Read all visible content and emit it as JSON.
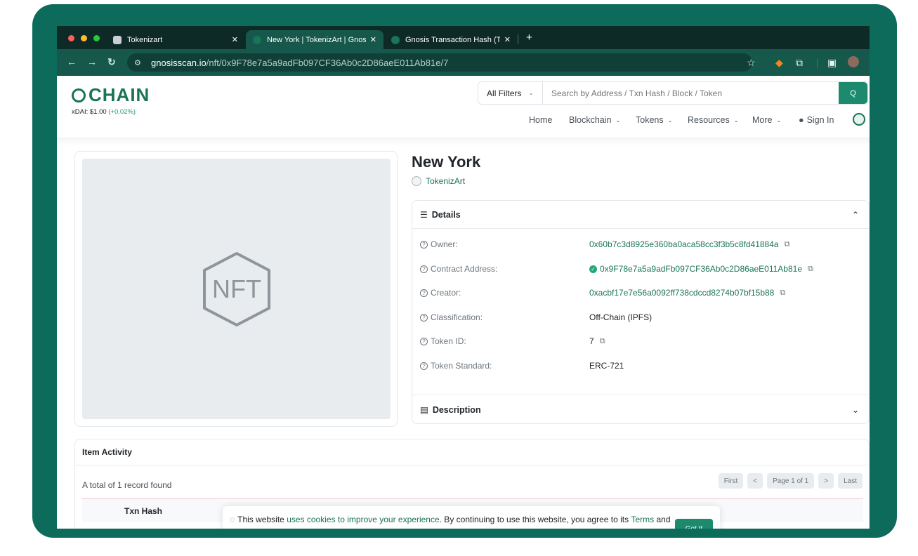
{
  "browser": {
    "tabs": [
      {
        "title": "Tokenizart",
        "active": false
      },
      {
        "title": "New York | TokenizArt | Gnosis",
        "active": true
      },
      {
        "title": "Gnosis Transaction Hash (Txh",
        "active": false
      }
    ],
    "new_tab": "+",
    "url_host": "gnosisscan.io",
    "url_path": "/nft/0x9F78e7a5a9adFb097CF36Ab0c2D86aeE011Ab81e/7"
  },
  "header": {
    "logo_text": "CHAIN",
    "price_label": "xDAI: $1.00",
    "price_change": "(+0.02%)",
    "filter_label": "All Filters",
    "search_placeholder": "Search by Address / Txn Hash / Block / Token",
    "search_button": "Q",
    "nav": [
      "Home",
      "Blockchain",
      "Tokens",
      "Resources",
      "More"
    ],
    "sign_in": "Sign In"
  },
  "nft": {
    "placeholder_text": "NFT",
    "title": "New York",
    "collection": "TokenizArt"
  },
  "details": {
    "heading": "Details",
    "rows": [
      {
        "label": "Owner:",
        "value": "0x60b7c3d8925e360ba0aca58cc3f3b5c8fd41884a"
      },
      {
        "label": "Contract Address:",
        "value": "0x9F78e7a5a9adFb097CF36Ab0c2D86aeE011Ab81e"
      },
      {
        "label": "Creator:",
        "value": "0xacbf17e7e56a0092ff738cdccd8274b07bf15b88"
      },
      {
        "label": "Classification:",
        "value": "Off-Chain (IPFS)"
      },
      {
        "label": "Token ID:",
        "value": "7"
      },
      {
        "label": "Token Standard:",
        "value": "ERC-721"
      }
    ],
    "description_heading": "Description"
  },
  "activity": {
    "heading": "Item Activity",
    "total": "A total of 1 record found",
    "pager": {
      "first": "First",
      "prev": "<",
      "page": "Page 1 of 1",
      "next": ">",
      "last": "Last"
    },
    "col_txn_hash": "Txn Hash"
  },
  "cookie": {
    "text_1": "This website ",
    "link_1": "uses cookies to improve your experience",
    "text_2": ". By continuing to use this website, you agree to its ",
    "link_2": "Terms",
    "text_3": " and",
    "button": "Got It"
  },
  "colors": {
    "frame": "#0d6b5c",
    "brand_green": "#1a7457",
    "button_green": "#1d8a6e"
  }
}
